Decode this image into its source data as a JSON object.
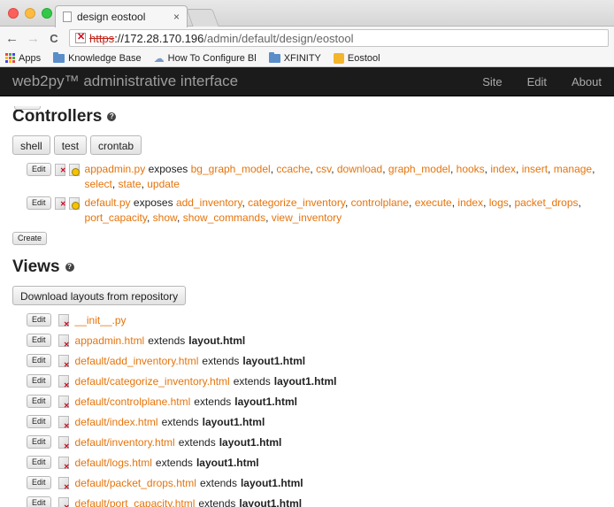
{
  "browser": {
    "tab_title": "design eostool",
    "tab_close": "×",
    "url_scheme": "https",
    "url_host": "://172.28.170.196",
    "url_path": "/admin/default/design/eostool",
    "back": "←",
    "forward": "→",
    "reload": "C",
    "bookmarks": [
      {
        "label": "Apps",
        "icon": "apps-icon"
      },
      {
        "label": "Knowledge Base",
        "icon": "folder-icon"
      },
      {
        "label": "How To Configure Bl",
        "icon": "cloud-icon"
      },
      {
        "label": "XFINITY",
        "icon": "folder-icon"
      },
      {
        "label": "Eostool",
        "icon": "eostool-icon"
      }
    ]
  },
  "navbar": {
    "brand": "web2py™ administrative interface",
    "links": [
      "Site",
      "Edit",
      "About"
    ]
  },
  "controllers": {
    "heading": "Controllers",
    "buttons": [
      "shell",
      "test",
      "crontab"
    ],
    "edit_label": "Edit",
    "exposes_label": "exposes",
    "items": [
      {
        "file": "appadmin.py",
        "functions": [
          "bg_graph_model",
          "ccache",
          "csv",
          "download",
          "graph_model",
          "hooks",
          "index",
          "insert",
          "manage",
          "select",
          "state",
          "update"
        ]
      },
      {
        "file": "default.py",
        "functions": [
          "add_inventory",
          "categorize_inventory",
          "controlplane",
          "execute",
          "index",
          "logs",
          "packet_drops",
          "port_capacity",
          "show",
          "show_commands",
          "view_inventory"
        ]
      }
    ],
    "create_label": "Create"
  },
  "views": {
    "heading": "Views",
    "download_label": "Download layouts from repository",
    "edit_label": "Edit",
    "extends_label": "extends",
    "items": [
      {
        "file": "__init__.py",
        "layout": ""
      },
      {
        "file": "appadmin.html",
        "layout": "layout.html"
      },
      {
        "file": "default/add_inventory.html",
        "layout": "layout1.html"
      },
      {
        "file": "default/categorize_inventory.html",
        "layout": "layout1.html"
      },
      {
        "file": "default/controlplane.html",
        "layout": "layout1.html"
      },
      {
        "file": "default/index.html",
        "layout": "layout1.html"
      },
      {
        "file": "default/inventory.html",
        "layout": "layout1.html"
      },
      {
        "file": "default/logs.html",
        "layout": "layout1.html"
      },
      {
        "file": "default/packet_drops.html",
        "layout": "layout1.html"
      },
      {
        "file": "default/port_capacity.html",
        "layout": "layout1.html"
      }
    ]
  },
  "colors": {
    "link": "#e6740b",
    "navbar_bg": "#1b1b1b"
  }
}
